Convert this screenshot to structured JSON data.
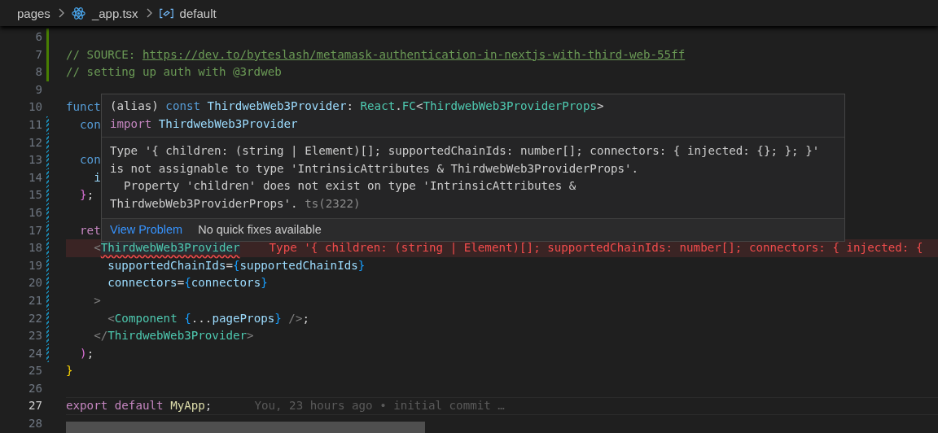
{
  "breadcrumb": [
    {
      "label": "pages",
      "kind": "folder"
    },
    {
      "label": "_app.tsx",
      "kind": "react"
    },
    {
      "label": "default",
      "kind": "symbol"
    }
  ],
  "lines": [
    {
      "number": "6",
      "kind": "added"
    },
    {
      "number": "7",
      "kind": "added",
      "tokens": [
        {
          "text": "// SOURCE: ",
          "kind": "comment"
        },
        {
          "text": "https://dev.to/byteslash/metamask-authentication-in-nextjs-with-third-web-55ff",
          "kind": "link"
        }
      ]
    },
    {
      "number": "8",
      "kind": "added",
      "tokens": [
        {
          "text": "// setting up auth with @3rdweb",
          "kind": "comment"
        }
      ]
    },
    {
      "number": "9",
      "kind": "plain"
    },
    {
      "number": "10",
      "kind": "plain",
      "tokens": [
        {
          "text": "funct",
          "kind": "keyword"
        }
      ]
    },
    {
      "number": "11",
      "kind": "modified",
      "tokens": [
        {
          "text": "  con",
          "kind": "keyword"
        }
      ]
    },
    {
      "number": "12",
      "kind": "modified"
    },
    {
      "number": "13",
      "kind": "modified",
      "tokens": [
        {
          "text": "  con",
          "kind": "keyword"
        }
      ]
    },
    {
      "number": "14",
      "kind": "modified",
      "tokens": [
        {
          "text": "    i",
          "kind": "variable"
        }
      ]
    },
    {
      "number": "15",
      "kind": "modified",
      "tokens": [
        {
          "text": "  }",
          "kind": "brace2"
        },
        {
          "text": ";",
          "kind": "plain"
        }
      ]
    },
    {
      "number": "16",
      "kind": "modified"
    },
    {
      "number": "17",
      "kind": "modified",
      "tokens": [
        {
          "text": "  ret",
          "kind": "control"
        }
      ]
    },
    {
      "number": "18",
      "kind": "modified",
      "error": true,
      "inline_error": "Type '{ children: (string | Element)[]; supportedChainIds: number[]; connectors: { injected: {",
      "tokens": [
        {
          "text": "    <",
          "kind": "tag"
        },
        {
          "text": "ThirdwebWeb3Provider",
          "kind": "squiggle"
        }
      ]
    },
    {
      "number": "19",
      "kind": "modified",
      "tokens": [
        {
          "text": "      supportedChainIds",
          "kind": "variable"
        },
        {
          "text": "=",
          "kind": "plain"
        },
        {
          "text": "{",
          "kind": "brace3"
        },
        {
          "text": "supportedChainIds",
          "kind": "variable"
        },
        {
          "text": "}",
          "kind": "brace3"
        }
      ]
    },
    {
      "number": "20",
      "kind": "modified",
      "tokens": [
        {
          "text": "      connectors",
          "kind": "variable"
        },
        {
          "text": "=",
          "kind": "plain"
        },
        {
          "text": "{",
          "kind": "brace3"
        },
        {
          "text": "connectors",
          "kind": "variable"
        },
        {
          "text": "}",
          "kind": "brace3"
        }
      ]
    },
    {
      "number": "21",
      "kind": "modified",
      "tokens": [
        {
          "text": "    >",
          "kind": "tag"
        }
      ]
    },
    {
      "number": "22",
      "kind": "modified",
      "tokens": [
        {
          "text": "      <",
          "kind": "tag"
        },
        {
          "text": "Component",
          "kind": "type"
        },
        {
          "text": " {",
          "kind": "brace3"
        },
        {
          "text": "...",
          "kind": "plain"
        },
        {
          "text": "pageProps",
          "kind": "variable"
        },
        {
          "text": "}",
          "kind": "brace3"
        },
        {
          "text": " />",
          "kind": "tag"
        },
        {
          "text": ";",
          "kind": "plain"
        }
      ]
    },
    {
      "number": "23",
      "kind": "modified",
      "tokens": [
        {
          "text": "    </",
          "kind": "tag"
        },
        {
          "text": "ThirdwebWeb3Provider",
          "kind": "type"
        },
        {
          "text": ">",
          "kind": "tag"
        }
      ]
    },
    {
      "number": "24",
      "kind": "modified",
      "tokens": [
        {
          "text": "  )",
          "kind": "brace2"
        },
        {
          "text": ";",
          "kind": "plain"
        }
      ]
    },
    {
      "number": "25",
      "kind": "plain",
      "tokens": [
        {
          "text": "}",
          "kind": "brace1"
        }
      ]
    },
    {
      "number": "26",
      "kind": "plain"
    },
    {
      "number": "27",
      "kind": "plain",
      "current": true,
      "blame": "You, 23 hours ago • initial commit …",
      "tokens": [
        {
          "text": "export default ",
          "kind": "control"
        },
        {
          "text": "MyApp",
          "kind": "function"
        },
        {
          "text": ";",
          "kind": "plain"
        }
      ]
    },
    {
      "number": "28",
      "kind": "plain"
    }
  ],
  "hover": {
    "signature": [
      [
        {
          "text": "(alias) ",
          "kind": "plain"
        },
        {
          "text": "const ",
          "kind": "keyword"
        },
        {
          "text": "ThirdwebWeb3Provider",
          "kind": "variable"
        },
        {
          "text": ": ",
          "kind": "plain"
        },
        {
          "text": "React",
          "kind": "type"
        },
        {
          "text": ".",
          "kind": "plain"
        },
        {
          "text": "FC",
          "kind": "type"
        },
        {
          "text": "<",
          "kind": "plain"
        },
        {
          "text": "ThirdwebWeb3ProviderProps",
          "kind": "type"
        },
        {
          "text": ">",
          "kind": "plain"
        }
      ],
      [
        {
          "text": "import ",
          "kind": "control"
        },
        {
          "text": "ThirdwebWeb3Provider",
          "kind": "variable"
        }
      ]
    ],
    "message": "Type '{ children: (string | Element)[]; supportedChainIds: number[]; connectors: { injected: {}; }; }'\nis not assignable to type 'IntrinsicAttributes & ThirdwebWeb3ProviderProps'.\n  Property 'children' does not exist on type 'IntrinsicAttributes &\nThirdwebWeb3ProviderProps'.",
    "error_code": "ts(2322)",
    "action": "View Problem",
    "note": "No quick fixes available"
  }
}
